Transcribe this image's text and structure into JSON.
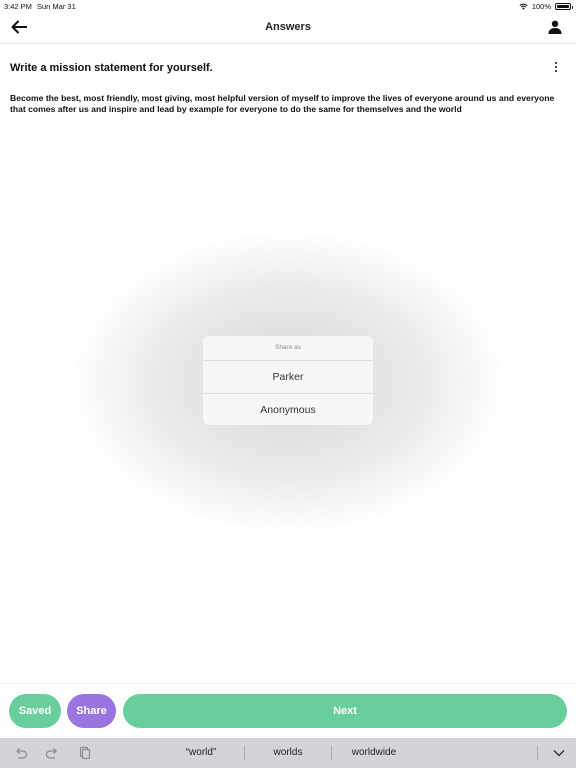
{
  "status_bar": {
    "time": "3:42 PM",
    "date": "Sun Mar 31",
    "battery": "100%",
    "battery_level": 1.0
  },
  "nav": {
    "title": "Answers",
    "back_icon": "arrow-left-icon",
    "profile_icon": "person-icon"
  },
  "question": {
    "title": "Write a mission statement for yourself.",
    "answer": "Become the best, most friendly, most giving, most helpful version of myself to improve the lives of everyone around us and everyone that comes after us and inspire and lead by example for everyone to do the same for themselves and the world"
  },
  "share_sheet": {
    "header": "Share as",
    "options": [
      "Parker",
      "Anonymous"
    ]
  },
  "actions": {
    "saved_label": "Saved",
    "share_label": "Share",
    "next_label": "Next"
  },
  "colors": {
    "green": "#68ce9b",
    "purple": "#9a74df",
    "keyboard_bar": "#d2d4d8"
  },
  "keyboard": {
    "suggestions": [
      "“world”",
      "worlds",
      "worldwide"
    ],
    "icons": [
      "undo-icon",
      "redo-icon",
      "paste-icon",
      "chevron-down-icon"
    ]
  }
}
